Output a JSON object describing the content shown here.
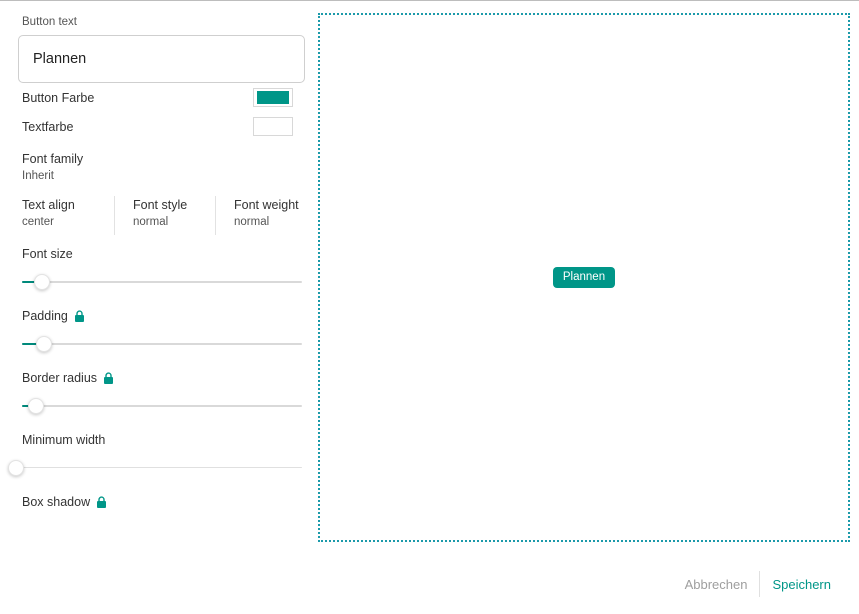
{
  "theme": {
    "accent": "#009688",
    "accent_dark": "#00897b",
    "preview_border": "#1b9aaa",
    "muted": "#9e9e9e"
  },
  "controls": {
    "button_text": {
      "label": "Button text",
      "value": "Plannen",
      "placeholder": "Button text"
    },
    "button_color": {
      "label": "Button Farbe",
      "value": "#009688"
    },
    "text_color": {
      "label": "Textfarbe",
      "value": "#ffffff"
    },
    "font_family": {
      "label": "Font family",
      "value": "Inherit"
    },
    "text_align": {
      "label": "Text align",
      "value": "center"
    },
    "font_style": {
      "label": "Font style",
      "value": "normal"
    },
    "font_weight": {
      "label": "Font weight",
      "value": "normal"
    },
    "font_size": {
      "label": "Font size",
      "locked": false,
      "lock_icon": "",
      "percent": 7
    },
    "padding": {
      "label": "Padding",
      "locked": true,
      "lock_icon": "lock-icon",
      "percent": 8
    },
    "border_radius": {
      "label": "Border radius",
      "locked": true,
      "lock_icon": "lock-icon",
      "percent": 5
    },
    "minimum_width": {
      "label": "Minimum width",
      "locked": false,
      "lock_icon": "",
      "percent": 0
    },
    "box_shadow": {
      "label": "Box shadow",
      "locked": true,
      "lock_icon": "lock-icon"
    }
  },
  "preview": {
    "button_label": "Plannen"
  },
  "footer": {
    "cancel_label": "Abbrechen",
    "save_label": "Speichern"
  }
}
